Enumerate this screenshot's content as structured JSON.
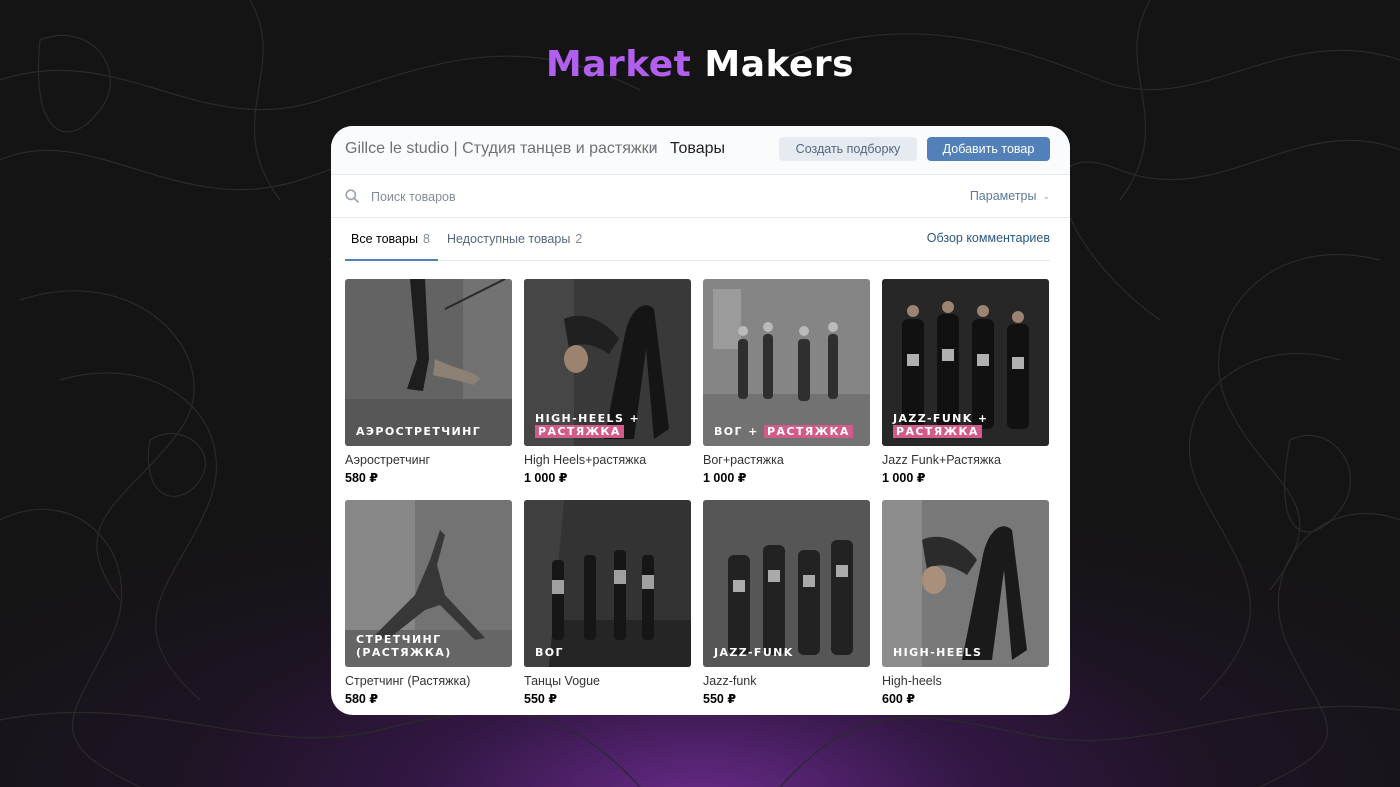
{
  "brand": {
    "word1": "Market",
    "word2": "Makers"
  },
  "colors": {
    "brand_accent": "#b25ff0",
    "primary_button": "#5181b8",
    "label_highlight": "#d15c8a"
  },
  "header": {
    "shop_name": "Gillce le studio | Студия танцев и растяжки",
    "chevron_icon": "chevron-right-icon",
    "current_page": "Товары",
    "create_collection_label": "Создать подборку",
    "add_product_label": "Добавить товар"
  },
  "search": {
    "placeholder": "Поиск товаров",
    "icon": "search-icon",
    "params_label": "Параметры"
  },
  "tabs": {
    "all_label": "Все товары",
    "all_count": "8",
    "unavailable_label": "Недоступные товары",
    "unavailable_count": "2",
    "review_link": "Обзор комментариев"
  },
  "products": [
    {
      "name": "Аэростретчинг",
      "price": "580 ₽",
      "overlay": [
        "Аэростретчинг"
      ],
      "highlight": []
    },
    {
      "name": "High Heels+растяжка",
      "price": "1 000 ₽",
      "overlay": [
        "High-heels +",
        "Растяжка"
      ],
      "highlight": [
        1
      ]
    },
    {
      "name": "Вог+растяжка",
      "price": "1 000 ₽",
      "overlay": [
        "Вог + Растяжка"
      ],
      "highlight": []
    },
    {
      "name": "Jazz Funk+Растяжка",
      "price": "1 000 ₽",
      "overlay": [
        "Jazz-funk +",
        "Растяжка"
      ],
      "highlight": [
        1
      ]
    },
    {
      "name": "Стретчинг (Растяжка)",
      "price": "580 ₽",
      "overlay": [
        "Стретчинг",
        "(растяжка)"
      ],
      "highlight": []
    },
    {
      "name": "Танцы Vogue",
      "price": "550 ₽",
      "overlay": [
        "Вог"
      ],
      "highlight": []
    },
    {
      "name": "Jazz-funk",
      "price": "550 ₽",
      "overlay": [
        "Jazz-funk"
      ],
      "highlight": []
    },
    {
      "name": "High-heels",
      "price": "600 ₽",
      "overlay": [
        "High-heels"
      ],
      "highlight": []
    }
  ]
}
